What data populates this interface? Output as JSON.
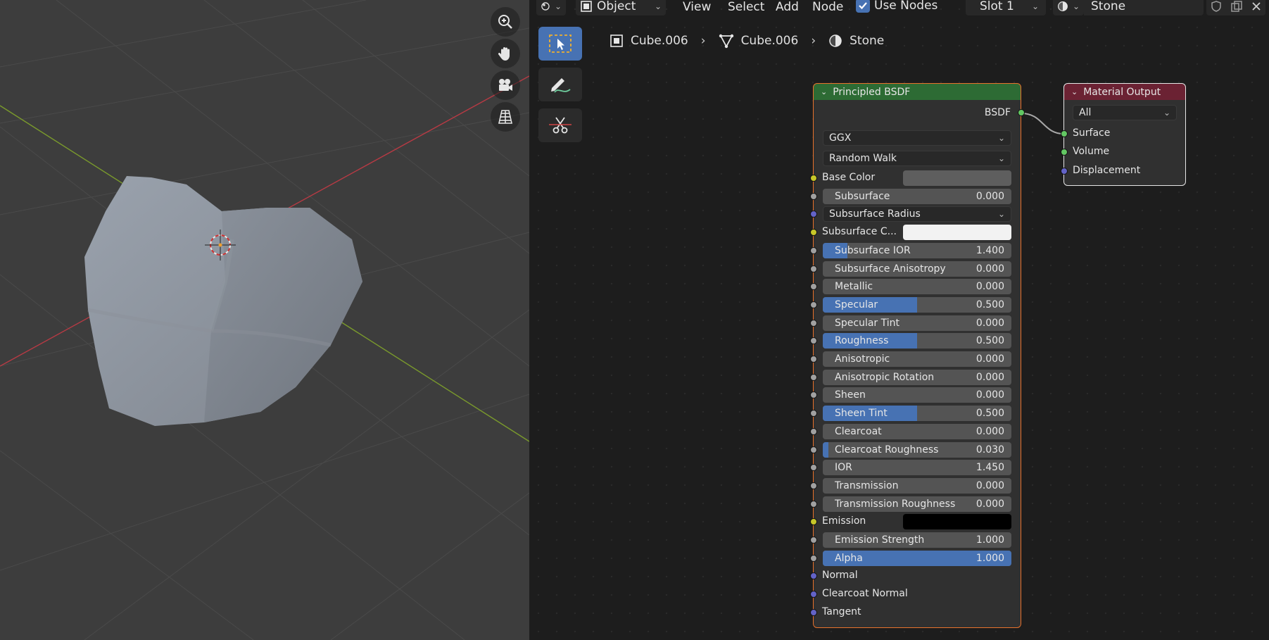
{
  "header": {
    "object_mode": "Object",
    "menus": [
      "View",
      "Select",
      "Add",
      "Node"
    ],
    "use_nodes_label": "Use Nodes",
    "slot": "Slot 1",
    "material_name": "Stone"
  },
  "breadcrumb": {
    "object": "Cube.006",
    "mesh": "Cube.006",
    "material": "Stone"
  },
  "bsdf_node": {
    "title": "Principled BSDF",
    "output_label": "BSDF",
    "distribution": "GGX",
    "subsurface_method": "Random Walk",
    "inputs": [
      {
        "label": "Base Color",
        "kind": "color",
        "color": "#5e5e5e"
      },
      {
        "label": "Subsurface",
        "kind": "value",
        "value": "0.000",
        "fraction": 0
      },
      {
        "label": "Subsurface Radius",
        "kind": "vector"
      },
      {
        "label": "Subsurface C...",
        "kind": "color",
        "color": "#f2f2f2"
      },
      {
        "label": "Subsurface IOR",
        "kind": "value",
        "value": "1.400",
        "fraction": 0.13
      },
      {
        "label": "Subsurface Anisotropy",
        "kind": "value",
        "value": "0.000",
        "fraction": 0
      },
      {
        "label": "Metallic",
        "kind": "value",
        "value": "0.000",
        "fraction": 0
      },
      {
        "label": "Specular",
        "kind": "value",
        "value": "0.500",
        "fraction": 0.5
      },
      {
        "label": "Specular Tint",
        "kind": "value",
        "value": "0.000",
        "fraction": 0
      },
      {
        "label": "Roughness",
        "kind": "value",
        "value": "0.500",
        "fraction": 0.5
      },
      {
        "label": "Anisotropic",
        "kind": "value",
        "value": "0.000",
        "fraction": 0
      },
      {
        "label": "Anisotropic Rotation",
        "kind": "value",
        "value": "0.000",
        "fraction": 0
      },
      {
        "label": "Sheen",
        "kind": "value",
        "value": "0.000",
        "fraction": 0
      },
      {
        "label": "Sheen Tint",
        "kind": "value",
        "value": "0.500",
        "fraction": 0.5
      },
      {
        "label": "Clearcoat",
        "kind": "value",
        "value": "0.000",
        "fraction": 0
      },
      {
        "label": "Clearcoat Roughness",
        "kind": "value",
        "value": "0.030",
        "fraction": 0.03
      },
      {
        "label": "IOR",
        "kind": "value",
        "value": "1.450",
        "fraction": 0
      },
      {
        "label": "Transmission",
        "kind": "value",
        "value": "0.000",
        "fraction": 0
      },
      {
        "label": "Transmission Roughness",
        "kind": "value",
        "value": "0.000",
        "fraction": 0
      },
      {
        "label": "Emission",
        "kind": "color",
        "color": "#000000"
      },
      {
        "label": "Emission Strength",
        "kind": "value",
        "value": "1.000",
        "fraction": 0
      },
      {
        "label": "Alpha",
        "kind": "value",
        "value": "1.000",
        "fraction": 1
      },
      {
        "label": "Normal",
        "kind": "vector_socket"
      },
      {
        "label": "Clearcoat Normal",
        "kind": "vector_socket"
      },
      {
        "label": "Tangent",
        "kind": "vector_socket"
      }
    ]
  },
  "output_node": {
    "title": "Material Output",
    "target": "All",
    "inputs": [
      "Surface",
      "Volume",
      "Displacement"
    ]
  },
  "colors": {
    "accent": "#4772b3",
    "bsdf_header": "#2d6b34",
    "output_header": "#6b2233",
    "node_selected_outline": "#e8722c"
  }
}
